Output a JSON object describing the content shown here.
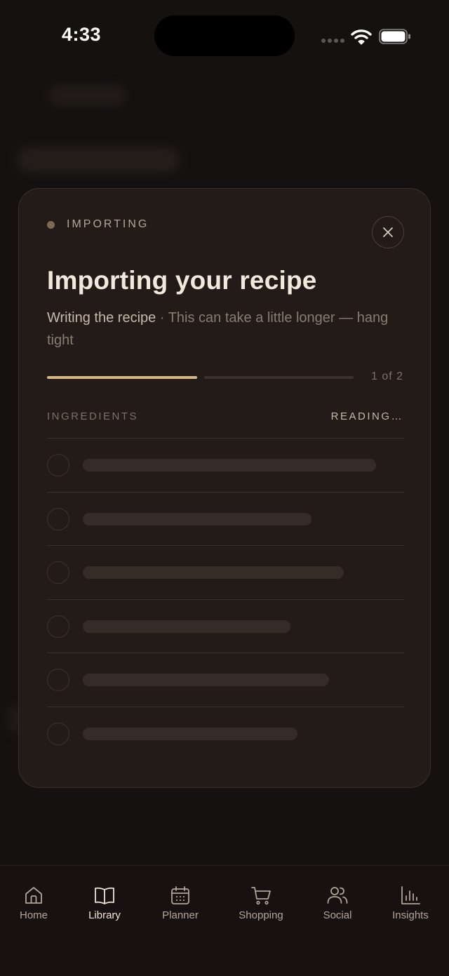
{
  "status_bar": {
    "time": "4:33"
  },
  "modal": {
    "status_label": "IMPORTING",
    "title": "Importing your recipe",
    "step_text": "Writing the recipe",
    "separator": " · ",
    "hint_text": "This can take a little longer — hang tight",
    "progress": {
      "current": 1,
      "total": 2,
      "label": "1 of 2"
    },
    "section_label": "INGREDIENTS",
    "section_status": "READING…",
    "skeleton_rows": 6
  },
  "tab_bar": {
    "items": [
      {
        "label": "Home",
        "icon": "home-icon",
        "active": false
      },
      {
        "label": "Library",
        "icon": "book-icon",
        "active": true
      },
      {
        "label": "Planner",
        "icon": "calendar-icon",
        "active": false
      },
      {
        "label": "Shopping",
        "icon": "cart-icon",
        "active": false
      },
      {
        "label": "Social",
        "icon": "users-icon",
        "active": false
      },
      {
        "label": "Insights",
        "icon": "bar-chart-icon",
        "active": false
      }
    ]
  },
  "colors": {
    "background": "#151110",
    "card": "#231b18",
    "accent": "#d6b888",
    "muted_text": "#8a7c70"
  }
}
